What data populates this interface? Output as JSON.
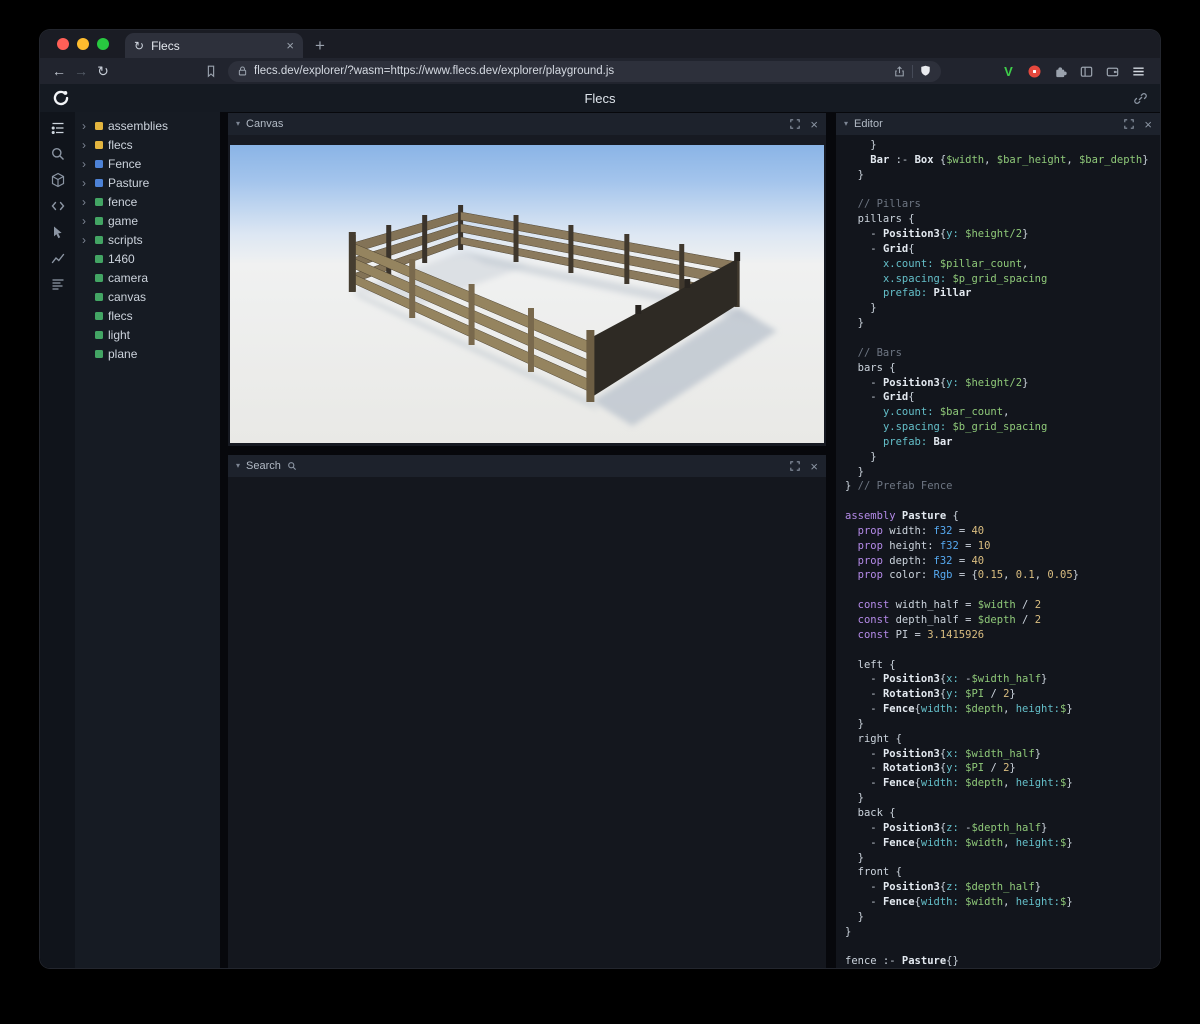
{
  "browser": {
    "traffic_lights": [
      "#ff5f57",
      "#febc2e",
      "#28c840"
    ],
    "tab_title": "Flecs",
    "close_tab_label": "×",
    "new_tab_label": "+",
    "back_label": "←",
    "forward_label": "→",
    "reload_label": "↻",
    "url": "flecs.dev/explorer/?wasm=https://www.flecs.dev/explorer/playground.js",
    "vimium_label": "V",
    "accent_red_extension": "#e5483d",
    "vimium_green": "#3ecf4a"
  },
  "app": {
    "title": "Flecs"
  },
  "sidebar": {
    "icons": [
      "entity-tree-icon",
      "query-search-icon",
      "entities-cube-icon",
      "script-code-icon",
      "inspect-cursor-icon",
      "stats-chart-icon",
      "commands-list-icon"
    ]
  },
  "tree": {
    "items": [
      {
        "label": "assemblies",
        "color": "#e3b53f",
        "expandable": true
      },
      {
        "label": "flecs",
        "color": "#e3b53f",
        "expandable": true
      },
      {
        "label": "Fence",
        "color": "#4d82d6",
        "expandable": true
      },
      {
        "label": "Pasture",
        "color": "#4d82d6",
        "expandable": true
      },
      {
        "label": "fence",
        "color": "#43a564",
        "expandable": true
      },
      {
        "label": "game",
        "color": "#43a564",
        "expandable": true
      },
      {
        "label": "scripts",
        "color": "#43a564",
        "expandable": true
      },
      {
        "label": "1460",
        "color": "#43a564",
        "expandable": false
      },
      {
        "label": "camera",
        "color": "#43a564",
        "expandable": false
      },
      {
        "label": "canvas",
        "color": "#43a564",
        "expandable": false
      },
      {
        "label": "flecs",
        "color": "#43a564",
        "expandable": false
      },
      {
        "label": "light",
        "color": "#43a564",
        "expandable": false
      },
      {
        "label": "plane",
        "color": "#43a564",
        "expandable": false
      }
    ]
  },
  "panels": {
    "canvas_title": "Canvas",
    "search_title": "Search",
    "editor_title": "Editor"
  },
  "editor": {
    "colors": {
      "p": "#ccd4dd",
      "c": "#6e7683",
      "k": "#b48ae8",
      "t": "#56a9f0",
      "v": "#8fc979",
      "key": "#64bfc9",
      "n": "#d9bd80",
      "b": "#e4eaf1"
    },
    "lines": [
      [
        [
          "p",
          "    }"
        ]
      ],
      [
        [
          "p",
          "    "
        ],
        [
          "b",
          "Bar"
        ],
        [
          "p",
          " :- "
        ],
        [
          "b",
          "Box"
        ],
        [
          "p",
          " {"
        ],
        [
          "v",
          "$width"
        ],
        [
          "p",
          ", "
        ],
        [
          "v",
          "$bar_height"
        ],
        [
          "p",
          ", "
        ],
        [
          "v",
          "$bar_depth"
        ],
        [
          "p",
          "}"
        ]
      ],
      [
        [
          "p",
          "  }"
        ]
      ],
      [],
      [
        [
          "c",
          "  // Pillars"
        ]
      ],
      [
        [
          "p",
          "  pillars {"
        ]
      ],
      [
        [
          "p",
          "    - "
        ],
        [
          "b",
          "Position3"
        ],
        [
          "p",
          "{"
        ],
        [
          "key",
          "y:"
        ],
        [
          "p",
          " "
        ],
        [
          "v",
          "$height/2"
        ],
        [
          "p",
          "}"
        ]
      ],
      [
        [
          "p",
          "    - "
        ],
        [
          "b",
          "Grid"
        ],
        [
          "p",
          "{"
        ]
      ],
      [
        [
          "p",
          "      "
        ],
        [
          "key",
          "x.count:"
        ],
        [
          "p",
          " "
        ],
        [
          "v",
          "$pillar_count"
        ],
        [
          "p",
          ","
        ]
      ],
      [
        [
          "p",
          "      "
        ],
        [
          "key",
          "x.spacing:"
        ],
        [
          "p",
          " "
        ],
        [
          "v",
          "$p_grid_spacing"
        ]
      ],
      [
        [
          "p",
          "      "
        ],
        [
          "key",
          "prefab:"
        ],
        [
          "p",
          " "
        ],
        [
          "b",
          "Pillar"
        ]
      ],
      [
        [
          "p",
          "    }"
        ]
      ],
      [
        [
          "p",
          "  }"
        ]
      ],
      [],
      [
        [
          "c",
          "  // Bars"
        ]
      ],
      [
        [
          "p",
          "  bars {"
        ]
      ],
      [
        [
          "p",
          "    - "
        ],
        [
          "b",
          "Position3"
        ],
        [
          "p",
          "{"
        ],
        [
          "key",
          "y:"
        ],
        [
          "p",
          " "
        ],
        [
          "v",
          "$height/2"
        ],
        [
          "p",
          "}"
        ]
      ],
      [
        [
          "p",
          "    - "
        ],
        [
          "b",
          "Grid"
        ],
        [
          "p",
          "{"
        ]
      ],
      [
        [
          "p",
          "      "
        ],
        [
          "key",
          "y.count:"
        ],
        [
          "p",
          " "
        ],
        [
          "v",
          "$bar_count"
        ],
        [
          "p",
          ","
        ]
      ],
      [
        [
          "p",
          "      "
        ],
        [
          "key",
          "y.spacing:"
        ],
        [
          "p",
          " "
        ],
        [
          "v",
          "$b_grid_spacing"
        ]
      ],
      [
        [
          "p",
          "      "
        ],
        [
          "key",
          "prefab:"
        ],
        [
          "p",
          " "
        ],
        [
          "b",
          "Bar"
        ]
      ],
      [
        [
          "p",
          "    }"
        ]
      ],
      [
        [
          "p",
          "  }"
        ]
      ],
      [
        [
          "p",
          "} "
        ],
        [
          "c",
          "// Prefab Fence"
        ]
      ],
      [],
      [
        [
          "k",
          "assembly"
        ],
        [
          "p",
          " "
        ],
        [
          "b",
          "Pasture"
        ],
        [
          "p",
          " {"
        ]
      ],
      [
        [
          "p",
          "  "
        ],
        [
          "k",
          "prop"
        ],
        [
          "p",
          " width: "
        ],
        [
          "t",
          "f32"
        ],
        [
          "p",
          " = "
        ],
        [
          "n",
          "40"
        ]
      ],
      [
        [
          "p",
          "  "
        ],
        [
          "k",
          "prop"
        ],
        [
          "p",
          " height: "
        ],
        [
          "t",
          "f32"
        ],
        [
          "p",
          " = "
        ],
        [
          "n",
          "10"
        ]
      ],
      [
        [
          "p",
          "  "
        ],
        [
          "k",
          "prop"
        ],
        [
          "p",
          " depth: "
        ],
        [
          "t",
          "f32"
        ],
        [
          "p",
          " = "
        ],
        [
          "n",
          "40"
        ]
      ],
      [
        [
          "p",
          "  "
        ],
        [
          "k",
          "prop"
        ],
        [
          "p",
          " color: "
        ],
        [
          "t",
          "Rgb"
        ],
        [
          "p",
          " = {"
        ],
        [
          "n",
          "0.15"
        ],
        [
          "p",
          ", "
        ],
        [
          "n",
          "0.1"
        ],
        [
          "p",
          ", "
        ],
        [
          "n",
          "0.05"
        ],
        [
          "p",
          "}"
        ]
      ],
      [],
      [
        [
          "p",
          "  "
        ],
        [
          "k",
          "const"
        ],
        [
          "p",
          " width_half = "
        ],
        [
          "v",
          "$width"
        ],
        [
          "p",
          " / "
        ],
        [
          "n",
          "2"
        ]
      ],
      [
        [
          "p",
          "  "
        ],
        [
          "k",
          "const"
        ],
        [
          "p",
          " depth_half = "
        ],
        [
          "v",
          "$depth"
        ],
        [
          "p",
          " / "
        ],
        [
          "n",
          "2"
        ]
      ],
      [
        [
          "p",
          "  "
        ],
        [
          "k",
          "const"
        ],
        [
          "p",
          " PI = "
        ],
        [
          "n",
          "3.1415926"
        ]
      ],
      [],
      [
        [
          "p",
          "  left {"
        ]
      ],
      [
        [
          "p",
          "    - "
        ],
        [
          "b",
          "Position3"
        ],
        [
          "p",
          "{"
        ],
        [
          "key",
          "x:"
        ],
        [
          "p",
          " -"
        ],
        [
          "v",
          "$width_half"
        ],
        [
          "p",
          "}"
        ]
      ],
      [
        [
          "p",
          "    - "
        ],
        [
          "b",
          "Rotation3"
        ],
        [
          "p",
          "{"
        ],
        [
          "key",
          "y:"
        ],
        [
          "p",
          " "
        ],
        [
          "v",
          "$PI"
        ],
        [
          "p",
          " / "
        ],
        [
          "n",
          "2"
        ],
        [
          "p",
          "}"
        ]
      ],
      [
        [
          "p",
          "    - "
        ],
        [
          "b",
          "Fence"
        ],
        [
          "p",
          "{"
        ],
        [
          "key",
          "width:"
        ],
        [
          "p",
          " "
        ],
        [
          "v",
          "$depth"
        ],
        [
          "p",
          ", "
        ],
        [
          "key",
          "height:"
        ],
        [
          "v",
          "$"
        ],
        [
          "p",
          "}"
        ]
      ],
      [
        [
          "p",
          "  }"
        ]
      ],
      [
        [
          "p",
          "  right {"
        ]
      ],
      [
        [
          "p",
          "    - "
        ],
        [
          "b",
          "Position3"
        ],
        [
          "p",
          "{"
        ],
        [
          "key",
          "x:"
        ],
        [
          "p",
          " "
        ],
        [
          "v",
          "$width_half"
        ],
        [
          "p",
          "}"
        ]
      ],
      [
        [
          "p",
          "    - "
        ],
        [
          "b",
          "Rotation3"
        ],
        [
          "p",
          "{"
        ],
        [
          "key",
          "y:"
        ],
        [
          "p",
          " "
        ],
        [
          "v",
          "$PI"
        ],
        [
          "p",
          " / "
        ],
        [
          "n",
          "2"
        ],
        [
          "p",
          "}"
        ]
      ],
      [
        [
          "p",
          "    - "
        ],
        [
          "b",
          "Fence"
        ],
        [
          "p",
          "{"
        ],
        [
          "key",
          "width:"
        ],
        [
          "p",
          " "
        ],
        [
          "v",
          "$depth"
        ],
        [
          "p",
          ", "
        ],
        [
          "key",
          "height:"
        ],
        [
          "v",
          "$"
        ],
        [
          "p",
          "}"
        ]
      ],
      [
        [
          "p",
          "  }"
        ]
      ],
      [
        [
          "p",
          "  back {"
        ]
      ],
      [
        [
          "p",
          "    - "
        ],
        [
          "b",
          "Position3"
        ],
        [
          "p",
          "{"
        ],
        [
          "key",
          "z:"
        ],
        [
          "p",
          " -"
        ],
        [
          "v",
          "$depth_half"
        ],
        [
          "p",
          "}"
        ]
      ],
      [
        [
          "p",
          "    - "
        ],
        [
          "b",
          "Fence"
        ],
        [
          "p",
          "{"
        ],
        [
          "key",
          "width:"
        ],
        [
          "p",
          " "
        ],
        [
          "v",
          "$width"
        ],
        [
          "p",
          ", "
        ],
        [
          "key",
          "height:"
        ],
        [
          "v",
          "$"
        ],
        [
          "p",
          "}"
        ]
      ],
      [
        [
          "p",
          "  }"
        ]
      ],
      [
        [
          "p",
          "  front {"
        ]
      ],
      [
        [
          "p",
          "    - "
        ],
        [
          "b",
          "Position3"
        ],
        [
          "p",
          "{"
        ],
        [
          "key",
          "z:"
        ],
        [
          "p",
          " "
        ],
        [
          "v",
          "$depth_half"
        ],
        [
          "p",
          "}"
        ]
      ],
      [
        [
          "p",
          "    - "
        ],
        [
          "b",
          "Fence"
        ],
        [
          "p",
          "{"
        ],
        [
          "key",
          "width:"
        ],
        [
          "p",
          " "
        ],
        [
          "v",
          "$width"
        ],
        [
          "p",
          ", "
        ],
        [
          "key",
          "height:"
        ],
        [
          "v",
          "$"
        ],
        [
          "p",
          "}"
        ]
      ],
      [
        [
          "p",
          "  }"
        ]
      ],
      [
        [
          "p",
          "}"
        ]
      ],
      [],
      [
        [
          "p",
          "fence :- "
        ],
        [
          "b",
          "Pasture"
        ],
        [
          "p",
          "{}"
        ]
      ]
    ]
  }
}
